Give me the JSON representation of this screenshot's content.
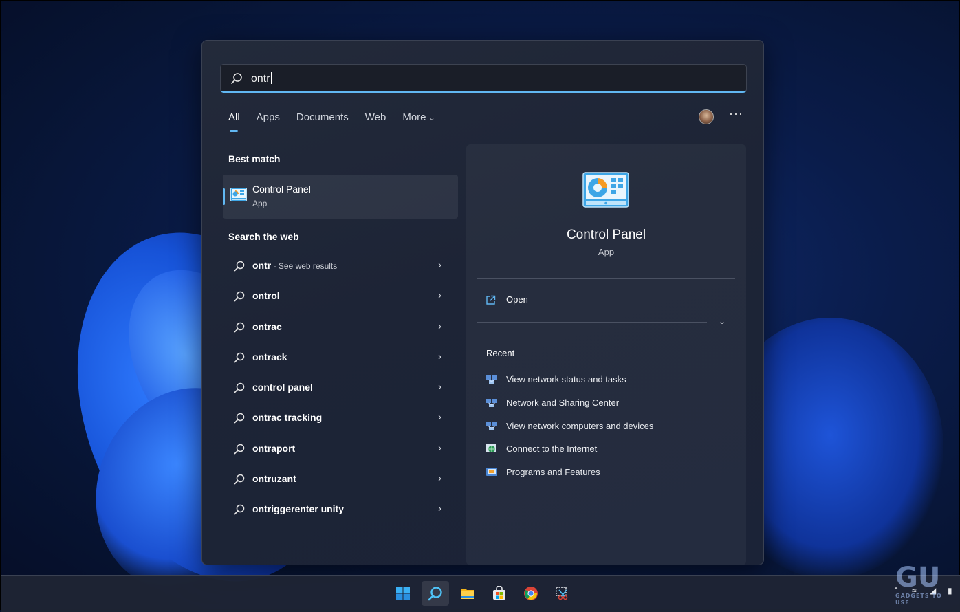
{
  "search": {
    "query": "ontr"
  },
  "tabs": [
    {
      "label": "All",
      "active": true
    },
    {
      "label": "Apps"
    },
    {
      "label": "Documents"
    },
    {
      "label": "Web"
    },
    {
      "label": "More"
    }
  ],
  "sections": {
    "best_match": "Best match",
    "search_web": "Search the web",
    "recent": "Recent"
  },
  "best_match": {
    "name": "Control Panel",
    "type": "App",
    "icon": "control-panel-icon"
  },
  "web_results": [
    {
      "label": "ontr",
      "sub": " - See web results"
    },
    {
      "label": "ontrol"
    },
    {
      "label": "ontrac"
    },
    {
      "label": "ontrack"
    },
    {
      "label": "control panel"
    },
    {
      "label": "ontrac tracking"
    },
    {
      "label": "ontraport"
    },
    {
      "label": "ontruzant"
    },
    {
      "label": "ontriggerenter unity"
    }
  ],
  "detail": {
    "name": "Control Panel",
    "type": "App",
    "open_label": "Open",
    "recent": [
      {
        "label": "View network status and tasks",
        "icon": "network-icon"
      },
      {
        "label": "Network and Sharing Center",
        "icon": "network-icon"
      },
      {
        "label": "View network computers and devices",
        "icon": "network-icon"
      },
      {
        "label": "Connect to the Internet",
        "icon": "globe-icon"
      },
      {
        "label": "Programs and Features",
        "icon": "programs-icon"
      }
    ]
  },
  "taskbar": {
    "apps": [
      "windows-start-icon",
      "search-icon",
      "file-explorer-icon",
      "microsoft-store-icon",
      "chrome-icon",
      "snipping-tool-icon"
    ],
    "tray": [
      "chevron-up-icon",
      "wifi-icon",
      "volume-icon",
      "battery-icon"
    ]
  },
  "watermark": {
    "mark": "GU",
    "text": "GADGETS TO USE"
  },
  "colors": {
    "accent": "#61b7f2",
    "panel": "#1d2436",
    "taskbar": "#1e2434"
  }
}
